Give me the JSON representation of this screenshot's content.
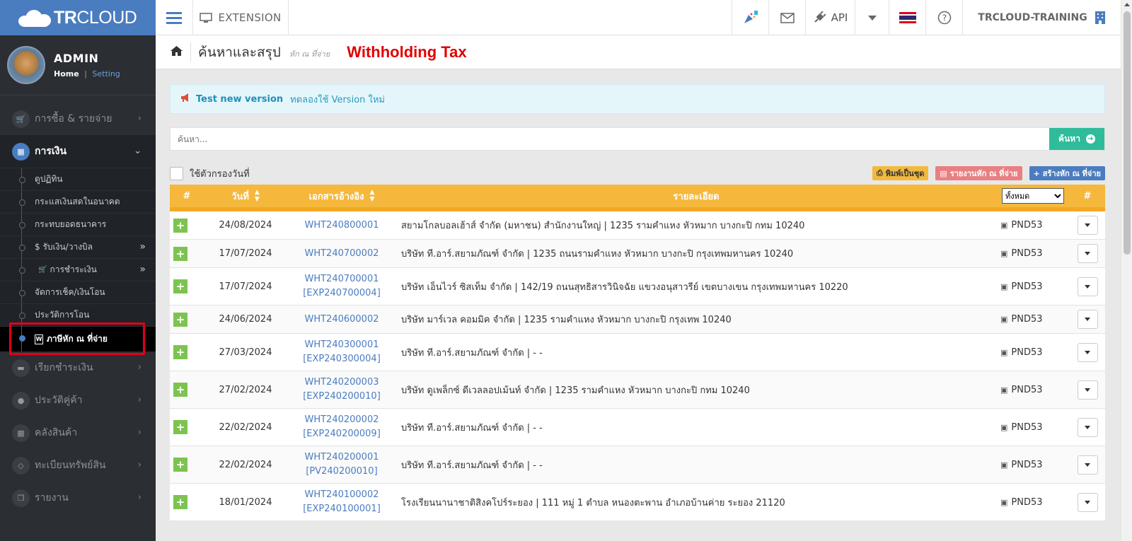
{
  "brand": {
    "prefix": "TR",
    "suffix": "CLOUD"
  },
  "topbar": {
    "extension_label": "EXTENSION",
    "api_label": "API",
    "user_label": "TRCLOUD-TRAINING"
  },
  "profile": {
    "name": "ADMIN",
    "home": "Home",
    "separator": "|",
    "setting": "Setting"
  },
  "sidebar": {
    "items_top": [
      {
        "label": "การซื้อ & รายจ่าย",
        "icon": "cart-icon"
      }
    ],
    "finance": {
      "label": "การเงิน"
    },
    "subs": [
      {
        "label": "ดูปฏิทิน"
      },
      {
        "label": "กระแสเงินสดในอนาคต"
      },
      {
        "label": "กระทบยอดธนาคาร"
      },
      {
        "label": "$ รับเงิน/วางบิล"
      },
      {
        "label": "การชำระเงิน"
      },
      {
        "label": "จัดการเช็ค/เงินโอน"
      },
      {
        "label": "ประวัติการโอน"
      },
      {
        "label": "ภาษีหัก ณ ที่จ่าย"
      }
    ],
    "items_bottom": [
      {
        "label": "เรียกชำระเงิน"
      },
      {
        "label": "ประวัติคู่ค้า"
      },
      {
        "label": "คลังสินค้า"
      },
      {
        "label": "ทะเบียนทรัพย์สิน"
      },
      {
        "label": "รายงาน"
      }
    ]
  },
  "page": {
    "title": "ค้นหาและสรุป",
    "subtitle": "หัก ณ ที่จ่าย",
    "highlight": "Withholding Tax"
  },
  "alert": {
    "strong": "Test new version",
    "text": "ทดลองใช้ Version ใหม่"
  },
  "search": {
    "placeholder": "ค้นหา...",
    "button": "ค้นหา"
  },
  "filter": {
    "date_filter_label": "ใช้ตัวกรองวันที่"
  },
  "tools": {
    "print": "พิมพ์เป็นชุด",
    "report": "รายงานหัก ณ ที่จ่าย",
    "create": "สร้างหัก ณ ที่จ่าย"
  },
  "table": {
    "headers": {
      "num": "#",
      "date": "วันที่",
      "ref": "เอกสารอ้างอิง",
      "detail": "รายละเอียด",
      "action": "#"
    },
    "filter_options": [
      "ทั้งหมด"
    ],
    "filter_selected": "ทั้งหมด",
    "rows": [
      {
        "date": "24/08/2024",
        "ref": "WHT240800001",
        "ref2": "",
        "detail": "สยามโกลบอลเฮ้าส์ จำกัด (มหาชน) สำนักงานใหญ่ | 1235 รามคำแหง หัวหมาก บางกะปิ กทม 10240",
        "type": "PND53"
      },
      {
        "date": "17/07/2024",
        "ref": "WHT240700002",
        "ref2": "",
        "detail": "บริษัท ที.อาร์.สยามภัณฑ์ จำกัด | 1235 ถนนรามคำแหง หัวหมาก บางกะปิ กรุงเทพมหานคร 10240",
        "type": "PND53"
      },
      {
        "date": "17/07/2024",
        "ref": "WHT240700001",
        "ref2": "[EXP240700004]",
        "detail": "บริษัท เอ็นไวร์ ซิสเท็ม จำกัด | 142/19 ถนนสุทธิสารวินิจฉัย แขวงอนุสาวรีย์ เขตบางเขน กรุงเทพมหานคร 10220",
        "type": "PND53"
      },
      {
        "date": "24/06/2024",
        "ref": "WHT240600002",
        "ref2": "",
        "detail": "บริษัท มาร์เวล คอมมิค จำกัด | 1235 รามคำแหง หัวหมาก บางกะปิ กรุงเทพ 10240",
        "type": "PND53"
      },
      {
        "date": "27/03/2024",
        "ref": "WHT240300001",
        "ref2": "[EXP240300004]",
        "detail": "บริษัท ที.อาร์.สยามภัณฑ์ จำกัด | - -",
        "type": "PND53"
      },
      {
        "date": "27/02/2024",
        "ref": "WHT240200003",
        "ref2": "[EXP240200010]",
        "detail": "บริษัท ดูเพล็กซ์ ดีเวลลอปเม้นท์ จำกัด | 1235 รามคำแหง หัวหมาก บางกะปิ กทม 10240",
        "type": "PND53"
      },
      {
        "date": "22/02/2024",
        "ref": "WHT240200002",
        "ref2": "[EXP240200009]",
        "detail": "บริษัท ที.อาร์.สยามภัณฑ์ จำกัด | - -",
        "type": "PND53"
      },
      {
        "date": "22/02/2024",
        "ref": "WHT240200001",
        "ref2": "[PV240200010]",
        "detail": "บริษัท ที.อาร์.สยามภัณฑ์ จำกัด | - -",
        "type": "PND53"
      },
      {
        "date": "18/01/2024",
        "ref": "WHT240100002",
        "ref2": "[EXP240100001]",
        "detail": "โรงเรียนนานาชาติสิงคโปร์ระยอง | 111 หมู่ 1 ตำบล หนองตะพาน อำเภอบ้านค่าย ระยอง 21120",
        "type": "PND53"
      }
    ]
  }
}
